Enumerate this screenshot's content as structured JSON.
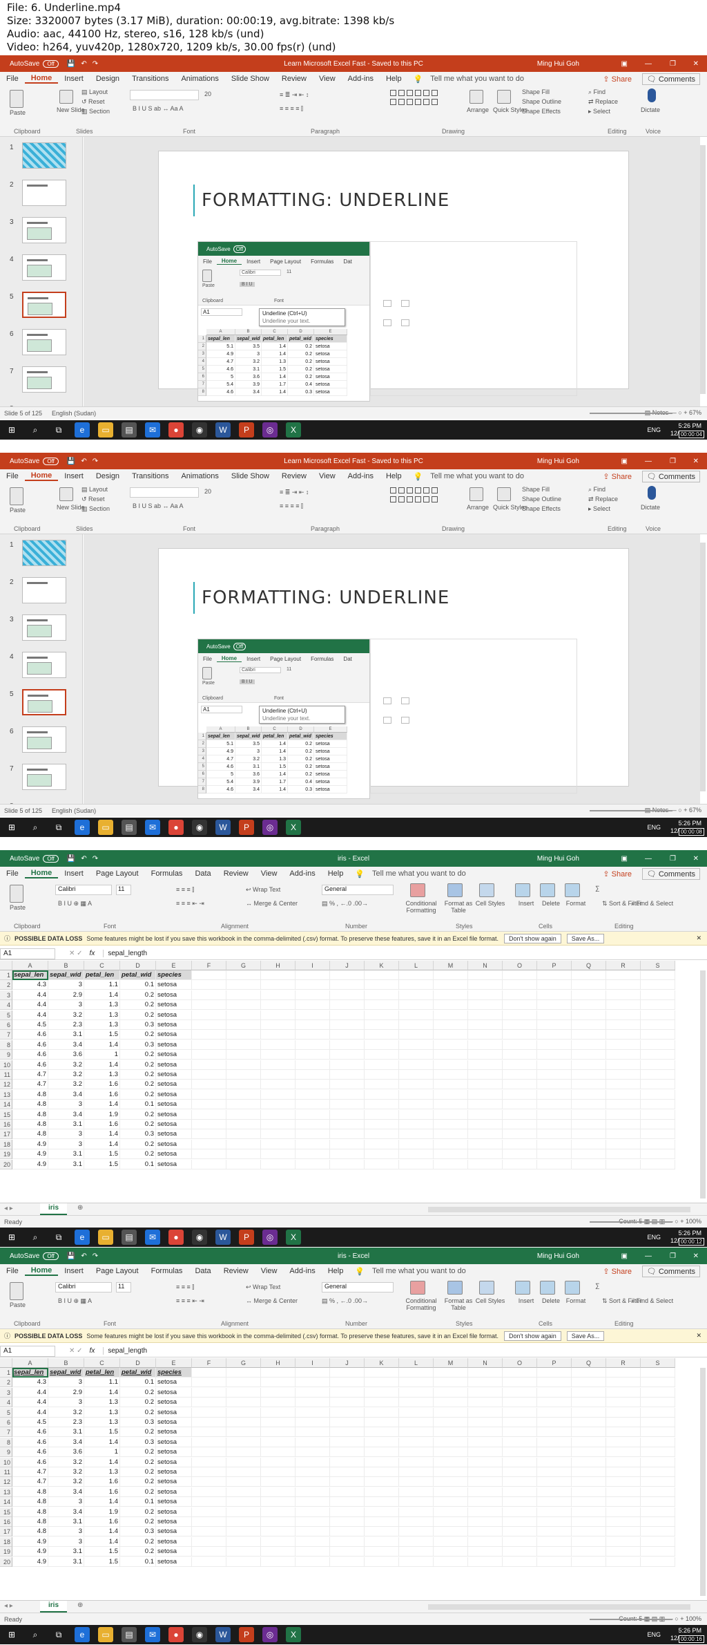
{
  "header": {
    "line1": "File: 6. Underline.mp4",
    "line2": "Size: 3320007 bytes (3.17 MiB), duration: 00:00:19, avg.bitrate: 1398 kb/s",
    "line3": "Audio: aac, 44100 Hz, stereo, s16, 128 kb/s (und)",
    "line4": "Video: h264, yuv420p, 1280x720, 1209 kb/s, 30.00 fps(r) (und)"
  },
  "common": {
    "autosave": "AutoSave",
    "autosave_state": "Off",
    "user": "Ming Hui Goh",
    "share": "Share",
    "comments": "Comments",
    "clock_time": "5:26 PM",
    "clock_date": "12/03/2019",
    "lang": "ENG",
    "colors": {
      "ppt": "#c43e1c",
      "excel": "#217346"
    }
  },
  "ppt": {
    "title": "Learn Microsoft Excel Fast  -  Saved to this PC",
    "tabs": [
      "File",
      "Home",
      "Insert",
      "Design",
      "Transitions",
      "Animations",
      "Slide Show",
      "Review",
      "View",
      "Add-ins",
      "Help"
    ],
    "search": "Tell me what you want to do",
    "groups": [
      "Clipboard",
      "Slides",
      "Font",
      "Paragraph",
      "Drawing",
      "Editing",
      "Voice"
    ],
    "ribbon": {
      "paste": "Paste",
      "new_slide": "New Slide",
      "layout": "Layout",
      "reset": "Reset",
      "section": "Section",
      "font_size": "20",
      "arrange": "Arrange",
      "quick_styles": "Quick Styles",
      "shape_fill": "Shape Fill",
      "shape_outline": "Shape Outline",
      "shape_effects": "Shape Effects",
      "find": "Find",
      "replace": "Replace",
      "select": "Select",
      "dictate": "Dictate"
    },
    "slide_numbers": [
      "1",
      "2",
      "3",
      "4",
      "5",
      "6",
      "7",
      "8"
    ],
    "slide_title": "FORMATTING: UNDERLINE",
    "status_left": "Slide 5 of 125",
    "status_lang": "English (Sudan)",
    "notes": "Notes",
    "zoom": "67%",
    "timestamps": [
      "00:00:04",
      "00:00:08"
    ]
  },
  "embed": {
    "autosave": "AutoSave",
    "autosave_state": "Off",
    "tabs": [
      "File",
      "Home",
      "Insert",
      "Page Layout",
      "Formulas",
      "Dat"
    ],
    "font": "Calibri",
    "font_size": "11",
    "paste": "Paste",
    "clipboard": "Clipboard",
    "font_group": "Font",
    "namebox": "A1",
    "tooltip_title": "Underline (Ctrl+U)",
    "tooltip_desc": "Underline your text.",
    "columns": [
      "A",
      "B",
      "C",
      "D",
      "E"
    ],
    "header_row": [
      "sepal_len",
      "sepal_wid",
      "petal_len",
      "petal_wid",
      "species"
    ],
    "rows": [
      [
        "5.1",
        "3.5",
        "1.4",
        "0.2",
        "setosa"
      ],
      [
        "4.9",
        "3",
        "1.4",
        "0.2",
        "setosa"
      ],
      [
        "4.7",
        "3.2",
        "1.3",
        "0.2",
        "setosa"
      ],
      [
        "4.6",
        "3.1",
        "1.5",
        "0.2",
        "setosa"
      ],
      [
        "5",
        "3.6",
        "1.4",
        "0.2",
        "setosa"
      ],
      [
        "5.4",
        "3.9",
        "1.7",
        "0.4",
        "setosa"
      ],
      [
        "4.6",
        "3.4",
        "1.4",
        "0.3",
        "setosa"
      ]
    ]
  },
  "excel": {
    "title": "iris  -  Excel",
    "tabs": [
      "File",
      "Home",
      "Insert",
      "Page Layout",
      "Formulas",
      "Data",
      "Review",
      "View",
      "Add-ins",
      "Help"
    ],
    "search": "Tell me what you want to do",
    "groups": [
      "Clipboard",
      "Font",
      "Alignment",
      "Number",
      "Styles",
      "Cells",
      "Editing"
    ],
    "ribbon": {
      "paste": "Paste",
      "font": "Calibri",
      "font_size": "11",
      "wrap_text": "Wrap Text",
      "merge_center": "Merge & Center",
      "number_format": "General",
      "conditional_formatting": "Conditional Formatting",
      "format_as_table": "Format as Table",
      "cell_styles": "Cell Styles",
      "insert": "Insert",
      "delete": "Delete",
      "format": "Format",
      "sort_filter": "Sort & Filter",
      "find_select": "Find & Select"
    },
    "info_label": "POSSIBLE DATA LOSS",
    "info_text": "Some features might be lost if you save this workbook in the comma-delimited (.csv) format. To preserve these features, save it in an Excel file format.",
    "dont_show": "Don't show again",
    "save_as": "Save As...",
    "namebox": "A1",
    "fx": "fx",
    "formula": "sepal_length",
    "columns": [
      "A",
      "B",
      "C",
      "D",
      "E",
      "F",
      "G",
      "H",
      "I",
      "J",
      "K",
      "L",
      "M",
      "N",
      "O",
      "P",
      "Q",
      "R",
      "S"
    ],
    "header_row": [
      "sepal_len",
      "sepal_wid",
      "petal_len",
      "petal_wid",
      "species"
    ],
    "rows": [
      [
        "4.3",
        "3",
        "1.1",
        "0.1",
        "setosa"
      ],
      [
        "4.4",
        "2.9",
        "1.4",
        "0.2",
        "setosa"
      ],
      [
        "4.4",
        "3",
        "1.3",
        "0.2",
        "setosa"
      ],
      [
        "4.4",
        "3.2",
        "1.3",
        "0.2",
        "setosa"
      ],
      [
        "4.5",
        "2.3",
        "1.3",
        "0.3",
        "setosa"
      ],
      [
        "4.6",
        "3.1",
        "1.5",
        "0.2",
        "setosa"
      ],
      [
        "4.6",
        "3.4",
        "1.4",
        "0.3",
        "setosa"
      ],
      [
        "4.6",
        "3.6",
        "1",
        "0.2",
        "setosa"
      ],
      [
        "4.6",
        "3.2",
        "1.4",
        "0.2",
        "setosa"
      ],
      [
        "4.7",
        "3.2",
        "1.3",
        "0.2",
        "setosa"
      ],
      [
        "4.7",
        "3.2",
        "1.6",
        "0.2",
        "setosa"
      ],
      [
        "4.8",
        "3.4",
        "1.6",
        "0.2",
        "setosa"
      ],
      [
        "4.8",
        "3",
        "1.4",
        "0.1",
        "setosa"
      ],
      [
        "4.8",
        "3.4",
        "1.9",
        "0.2",
        "setosa"
      ],
      [
        "4.8",
        "3.1",
        "1.6",
        "0.2",
        "setosa"
      ],
      [
        "4.8",
        "3",
        "1.4",
        "0.3",
        "setosa"
      ],
      [
        "4.9",
        "3",
        "1.4",
        "0.2",
        "setosa"
      ],
      [
        "4.9",
        "3.1",
        "1.5",
        "0.2",
        "setosa"
      ],
      [
        "4.9",
        "3.1",
        "1.5",
        "0.1",
        "setosa"
      ]
    ],
    "sheet": "iris",
    "status_left": "Ready",
    "count": "Count: 5",
    "zoom": "100%",
    "timestamps": [
      "00:00:12",
      "00:00:16"
    ]
  }
}
